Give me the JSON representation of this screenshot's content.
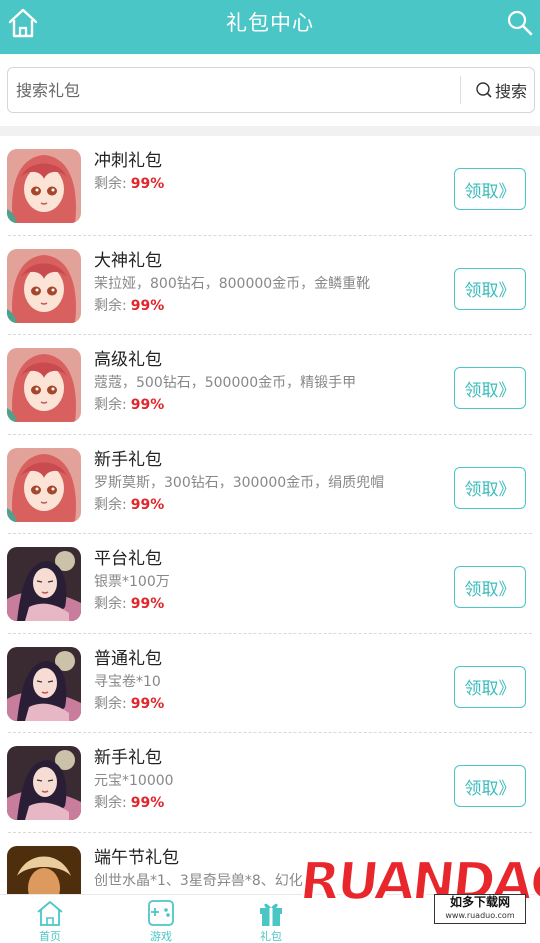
{
  "header": {
    "title": "礼包中心",
    "home_icon": "home-icon",
    "search_icon": "search-icon"
  },
  "search": {
    "placeholder": "搜索礼包",
    "value": "",
    "button_label": "搜索"
  },
  "remain_label": "剩余:",
  "claim_label": "领取》",
  "gifts": [
    {
      "name": "冲刺礼包",
      "desc": "",
      "remain": "99%",
      "thumb": "pink-hair"
    },
    {
      "name": "大神礼包",
      "desc": "茉拉娅，800钻石，800000金币，金鳞重靴",
      "remain": "99%",
      "thumb": "pink-hair"
    },
    {
      "name": "高级礼包",
      "desc": "蔻蔻，500钻石，500000金币，精锻手甲",
      "remain": "99%",
      "thumb": "pink-hair"
    },
    {
      "name": "新手礼包",
      "desc": "罗斯莫斯，300钻石，300000金币，绢质兜帽",
      "remain": "99%",
      "thumb": "pink-hair"
    },
    {
      "name": "平台礼包",
      "desc": "银票*100万",
      "remain": "99%",
      "thumb": "dark-hair"
    },
    {
      "name": "普通礼包",
      "desc": "寻宝卷*10",
      "remain": "99%",
      "thumb": "dark-hair"
    },
    {
      "name": "新手礼包",
      "desc": "元宝*10000",
      "remain": "99%",
      "thumb": "dark-hair"
    },
    {
      "name": "端午节礼包",
      "desc": "创世水晶*1、3星奇异兽*8、幻化",
      "remain": "",
      "thumb": "warrior"
    }
  ],
  "tabs": [
    {
      "label": "首页",
      "icon": "home-icon"
    },
    {
      "label": "游戏",
      "icon": "gamepad-icon"
    },
    {
      "label": "礼包",
      "icon": "gift-icon"
    }
  ],
  "watermark": {
    "brand": "RUANDAOO",
    "line1": "如多下载网",
    "line2": "www.ruaduo.com"
  },
  "colors": {
    "accent": "#4bc6c6",
    "remain_value": "#e0262b"
  }
}
